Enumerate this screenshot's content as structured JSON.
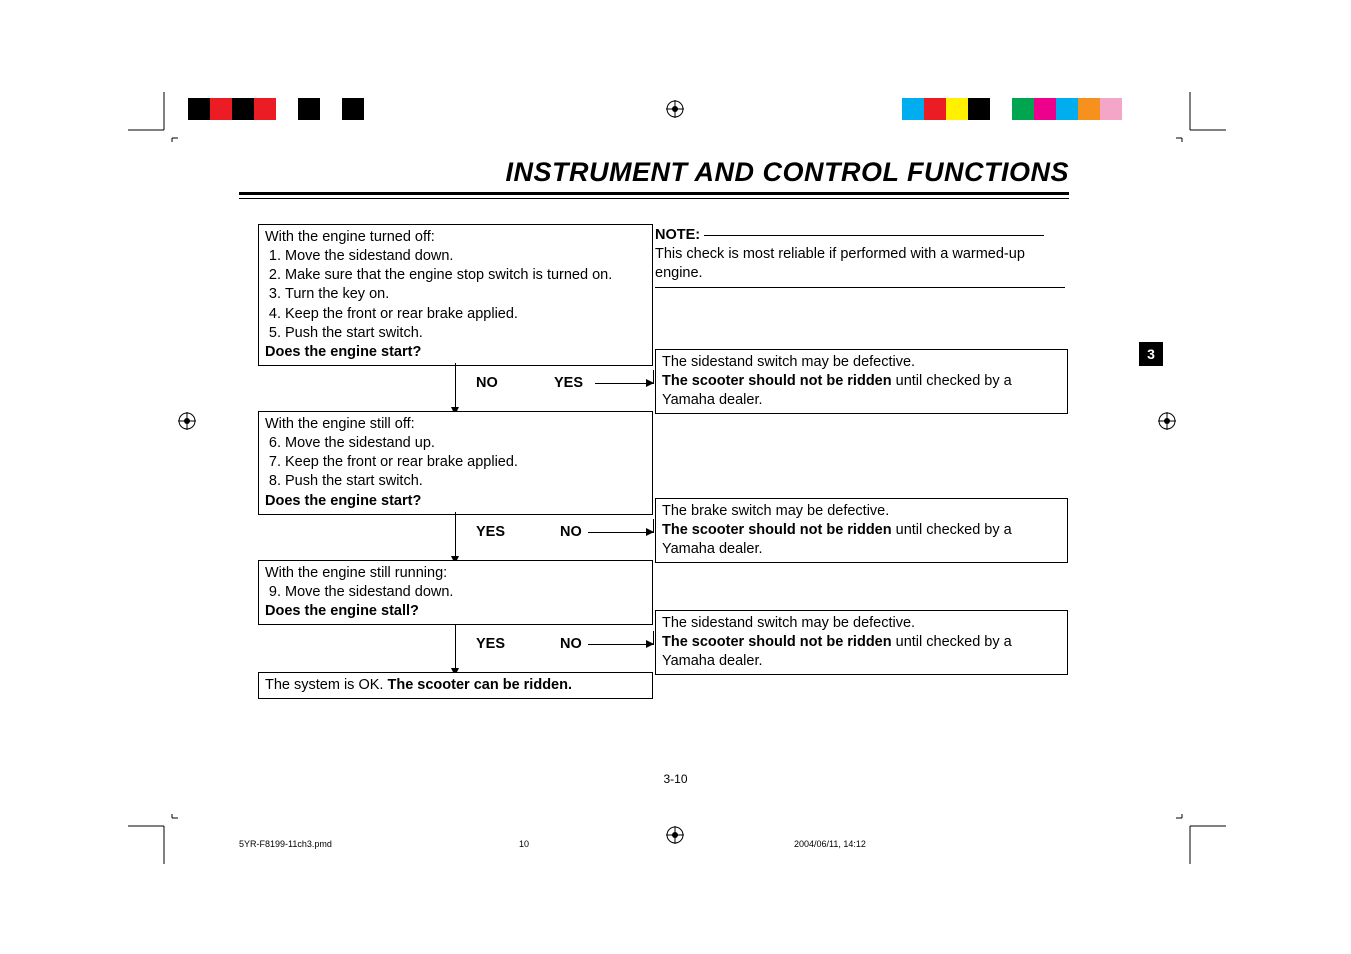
{
  "colorbars": {
    "left": [
      "#000000",
      "#ec1c24",
      "#000000",
      "#ec1c24",
      "#ffffff",
      "#000000",
      "#ffffff",
      "#000000",
      "#ffffff",
      "#ffffff"
    ],
    "right": [
      "#00adee",
      "#ec1c24",
      "#fff100",
      "#000000",
      "#ffffff",
      "#00a550",
      "#ed008c",
      "#00adee",
      "#f7911d",
      "#f4a6c9",
      "#ffffff",
      "#ffffff"
    ]
  },
  "title": "INSTRUMENT  AND  CONTROL  FUNCTIONS",
  "chapter_tab": "3",
  "note": {
    "label": "NOTE:",
    "text": "This check is most reliable if performed with a warmed-up engine."
  },
  "step1": {
    "intro": "With the engine turned off:",
    "items": [
      "Move the sidestand down.",
      "Make sure that the engine stop switch is turned on.",
      "Turn the key on.",
      "Keep the front or rear brake applied.",
      "Push the start switch."
    ],
    "question": "Does the engine start?",
    "no": "NO",
    "yes": "YES"
  },
  "step2": {
    "intro": "With the engine still off:",
    "items": [
      "Move the sidestand up.",
      "Keep the front or rear brake applied.",
      "Push the start switch."
    ],
    "start_num": 6,
    "question": "Does the engine start?",
    "yes": "YES",
    "no": "NO"
  },
  "step3": {
    "intro": "With the engine still running:",
    "items": [
      "Move the sidestand down."
    ],
    "start_num": 9,
    "question": "Does the engine stall?",
    "yes": "YES",
    "no": "NO"
  },
  "result_ok_prefix": "The system is OK. ",
  "result_ok_bold": "The scooter can be ridden.",
  "result1_line1": "The sidestand switch may be defective.",
  "result1_bold": "The scooter should not be ridden ",
  "result1_rest": "until checked by a Yamaha dealer.",
  "result2_line1": "The brake switch may be defective.",
  "result2_bold": "The scooter should not be ridden ",
  "result2_rest": "until checked by a Yamaha dealer.",
  "result3_line1": "The sidestand switch may be defective.",
  "result3_bold": "The scooter should not be ridden ",
  "result3_rest": "until checked by a Yamaha dealer.",
  "page_number": "3-10",
  "footer": {
    "file": "5YR-F8199-11ch3.pmd",
    "page": "10",
    "date": "2004/06/11, 14:12"
  }
}
